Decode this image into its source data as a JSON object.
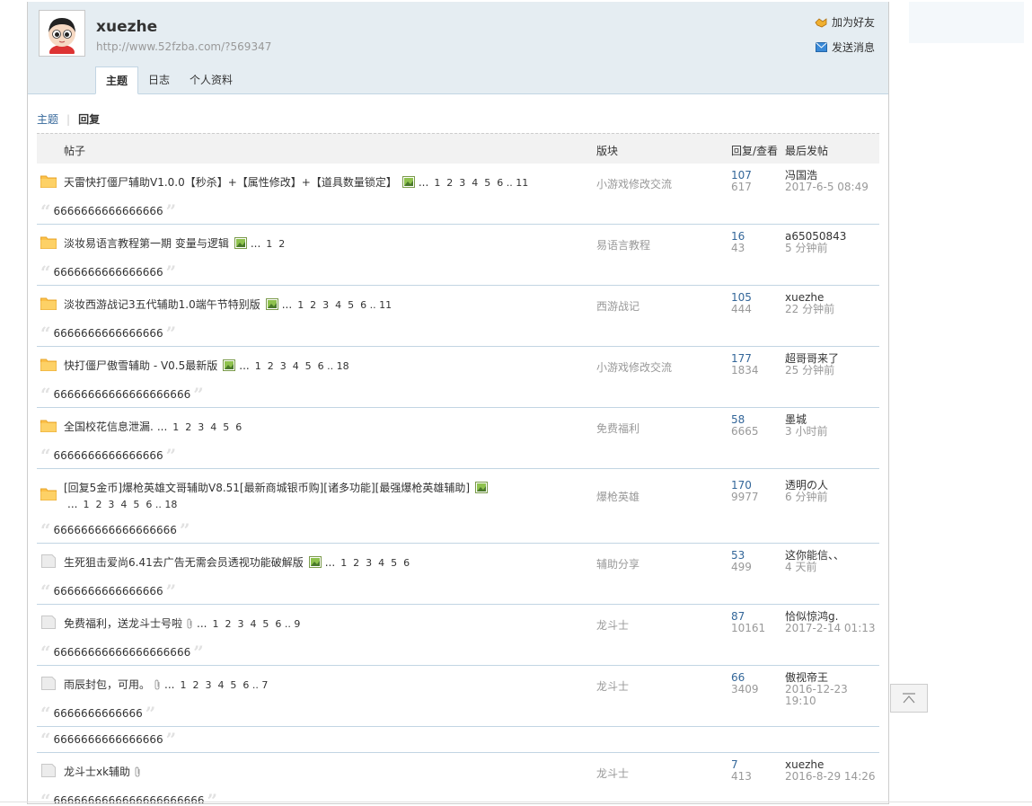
{
  "user": {
    "name": "xuezhe",
    "url": "http://www.52fzba.com/?569347",
    "add_friend": "加为好友",
    "send_message": "发送消息"
  },
  "tabs": [
    {
      "label": "主题",
      "active": true
    },
    {
      "label": "日志",
      "active": false
    },
    {
      "label": "个人资料",
      "active": false
    }
  ],
  "subnav": {
    "topics": "主题",
    "replies": "回复"
  },
  "table": {
    "headers": {
      "post": "帖子",
      "forum": "版块",
      "stats": "回复/查看",
      "last": "最后发帖"
    },
    "rows": [
      {
        "icon": "folder-icon",
        "title": "天雷快打僵尸辅助V1.0.0【秒杀】+【属性修改】+【道具数量锁定】",
        "pages": "1  2  3  4  5  6 .. 11",
        "attach": "pic",
        "forum": "小游戏修改交流",
        "replies": "107",
        "views": "617",
        "last_author": "冯国浩",
        "last_time": "2017-6-5 08:49",
        "quotes": [
          "6666666666666666"
        ]
      },
      {
        "icon": "folder-icon",
        "title": "淡妆易语言教程第一期 变量与逻辑",
        "pages": "1  2",
        "attach": "pic",
        "forum": "易语言教程",
        "replies": "16",
        "views": "43",
        "last_author": "a65050843",
        "last_time": "5 分钟前",
        "quotes": [
          "6666666666666666"
        ]
      },
      {
        "icon": "folder-icon",
        "title": "淡妆西游战记3五代辅助1.0端午节特别版",
        "pages": "1  2  3  4  5  6 .. 11",
        "attach": "pic",
        "forum": "西游战记",
        "replies": "105",
        "views": "444",
        "last_author": "xuezhe",
        "last_time": "22 分钟前",
        "quotes": [
          "6666666666666666"
        ]
      },
      {
        "icon": "folder-icon",
        "title": "快打僵尸傲雪辅助 - V0.5最新版",
        "pages": "1  2  3  4  5  6 .. 18",
        "attach": "pic",
        "forum": "小游戏修改交流",
        "replies": "177",
        "views": "1834",
        "last_author": "超哥哥来了",
        "last_time": "25 分钟前",
        "quotes": [
          "66666666666666666666"
        ]
      },
      {
        "icon": "folder-icon",
        "title": "全国校花信息泄漏.",
        "pages": "1  2  3  4  5  6",
        "attach": "none",
        "forum": "免费福利",
        "replies": "58",
        "views": "6665",
        "last_author": "墨城",
        "last_time": "3 小时前",
        "quotes": [
          "6666666666666666"
        ]
      },
      {
        "icon": "folder-icon",
        "title": "[回复5金币]爆枪英雄文哥辅助V8.51[最新商城银币购][诸多功能][最强爆枪英雄辅助]",
        "pages": "1  2  3  4  5  6 .. 18",
        "attach": "pic",
        "forum": "爆枪英雄",
        "replies": "170",
        "views": "9977",
        "last_author": "透明の人",
        "last_time": "6 分钟前",
        "quotes": [
          "666666666666666666"
        ],
        "tall": true
      },
      {
        "icon": "file-icon",
        "title": "生死狙击爱尚6.41去广告无需会员透视功能破解版",
        "pages": "1  2  3  4  5  6",
        "attach": "pic",
        "forum": "辅助分享",
        "replies": "53",
        "views": "499",
        "last_author": "这你能信、、",
        "last_time": "4 天前",
        "quotes": [
          "6666666666666666"
        ]
      },
      {
        "icon": "file-icon",
        "title": "免费福利，送龙斗士号啦",
        "pages": "1  2  3  4  5  6 .. 9",
        "attach": "clip",
        "forum": "龙斗士",
        "replies": "87",
        "views": "10161",
        "last_author": "恰似惊鸿g.",
        "last_time": "2017-2-14 01:13",
        "quotes": [
          "66666666666666666666"
        ]
      },
      {
        "icon": "file-icon",
        "title": "雨辰封包，可用。",
        "pages": "1  2  3  4  5  6 .. 7",
        "attach": "clip",
        "forum": "龙斗士",
        "replies": "66",
        "views": "3409",
        "last_author": "傲视帝王",
        "last_time": "2016-12-23 19:10",
        "quotes": [
          "6666666666666",
          "6666666666666666"
        ]
      },
      {
        "icon": "file-icon",
        "title": "龙斗士xk辅助",
        "pages": "",
        "attach": "clip",
        "forum": "龙斗士",
        "replies": "7",
        "views": "413",
        "last_author": "xuezhe",
        "last_time": "2016-8-29 14:26",
        "quotes": [
          "6666666666666666666666"
        ]
      }
    ]
  },
  "colors": {
    "header_bg": "#e5edf2",
    "link_blue": "#336699",
    "border": "#c2d5e3"
  }
}
